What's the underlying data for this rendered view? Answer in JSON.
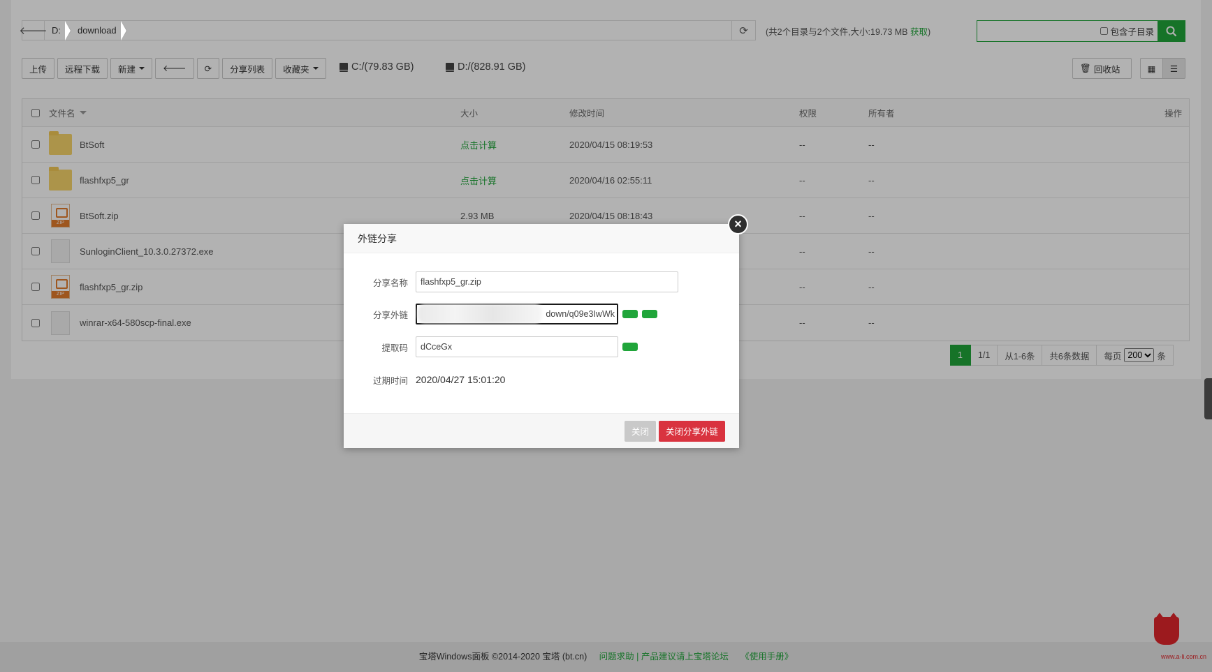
{
  "path_bar": {
    "drive": "D:",
    "folder": "download",
    "summary_prefix": "(共2个目录与2个文件,大小:19.73 MB ",
    "summary_link": "获取",
    "summary_suffix": ")"
  },
  "search": {
    "include_subdirs_label": "包含子目录"
  },
  "toolbar": {
    "upload": "上传",
    "remote_download": "远程下载",
    "new": "新建",
    "share_list": "分享列表",
    "favorites": "收藏夹",
    "drive_c": "C:/(79.83 GB)",
    "drive_d": "D:/(828.91 GB)",
    "recycle_bin": "回收站"
  },
  "table": {
    "headers": {
      "name": "文件名",
      "size": "大小",
      "mtime": "修改时间",
      "perm": "权限",
      "owner": "所有者",
      "ops": "操作"
    },
    "rows": [
      {
        "name": "BtSoft",
        "type": "folder",
        "size": "点击计算",
        "mtime": "2020/04/15 08:19:53",
        "perm": "--",
        "owner": "--"
      },
      {
        "name": "flashfxp5_gr",
        "type": "folder",
        "size": "点击计算",
        "mtime": "2020/04/16 02:55:11",
        "perm": "--",
        "owner": "--"
      },
      {
        "name": "BtSoft.zip",
        "type": "zip",
        "size": "2.93 MB",
        "mtime": "2020/04/15 08:18:43",
        "perm": "--",
        "owner": "--"
      },
      {
        "name": "SunloginClient_10.3.0.27372.exe",
        "type": "file",
        "size": "",
        "mtime": "",
        "perm": "--",
        "owner": "--"
      },
      {
        "name": "flashfxp5_gr.zip",
        "type": "zip",
        "size": "",
        "mtime": "",
        "perm": "--",
        "owner": "--"
      },
      {
        "name": "winrar-x64-580scp-final.exe",
        "type": "file",
        "size": "",
        "mtime": "",
        "perm": "--",
        "owner": "--"
      }
    ]
  },
  "pagination": {
    "current": "1",
    "pages": "1/1",
    "range": "从1-6条",
    "total": "共6条数据",
    "per_page_label": "每页",
    "per_page_value": "200",
    "unit": "条"
  },
  "dialog": {
    "title": "外链分享",
    "name_label": "分享名称",
    "name_value": "flashfxp5_gr.zip",
    "link_label": "分享外链",
    "link_value": "down/q09e3IwWk",
    "code_label": "提取码",
    "code_value": "dCceGx",
    "expire_label": "过期时间",
    "expire_value": "2020/04/27 15:01:20",
    "close_btn": "关闭",
    "close_share_btn": "关闭分享外链"
  },
  "footer": {
    "copyright": "宝塔Windows面板 ©2014-2020 宝塔 (bt.cn)",
    "help": "问题求助 | 产品建议请上宝塔论坛",
    "manual": "《使用手册》"
  },
  "watermark": "www.a-li.com.cn",
  "colors": {
    "accent": "#20a53a",
    "danger": "#d9333f"
  }
}
